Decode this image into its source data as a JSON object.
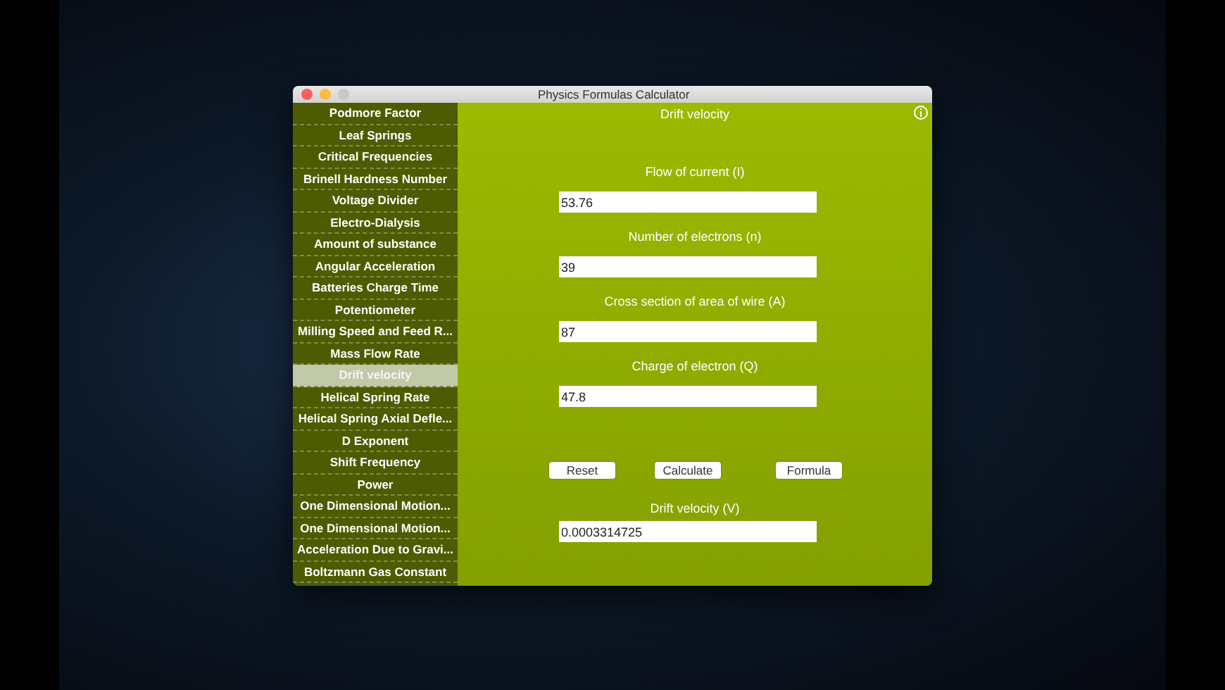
{
  "window": {
    "title": "Physics Formulas Calculator"
  },
  "sidebar": {
    "items": [
      {
        "label": "Podmore Factor",
        "selected": false
      },
      {
        "label": "Leaf Springs",
        "selected": false
      },
      {
        "label": "Critical Frequencies",
        "selected": false
      },
      {
        "label": "Brinell Hardness Number",
        "selected": false
      },
      {
        "label": "Voltage Divider",
        "selected": false
      },
      {
        "label": "Electro-Dialysis",
        "selected": false
      },
      {
        "label": "Amount of substance",
        "selected": false
      },
      {
        "label": "Angular Acceleration",
        "selected": false
      },
      {
        "label": "Batteries Charge Time",
        "selected": false
      },
      {
        "label": "Potentiometer",
        "selected": false
      },
      {
        "label": "Milling Speed and Feed R...",
        "selected": false
      },
      {
        "label": "Mass Flow Rate",
        "selected": false
      },
      {
        "label": "Drift velocity",
        "selected": true
      },
      {
        "label": "Helical Spring Rate",
        "selected": false
      },
      {
        "label": "Helical Spring Axial Defle...",
        "selected": false
      },
      {
        "label": "D Exponent",
        "selected": false
      },
      {
        "label": "Shift Frequency",
        "selected": false
      },
      {
        "label": "Power",
        "selected": false
      },
      {
        "label": "One Dimensional Motion...",
        "selected": false
      },
      {
        "label": "One Dimensional Motion...",
        "selected": false
      },
      {
        "label": "Acceleration Due to Gravi...",
        "selected": false
      },
      {
        "label": "Boltzmann Gas Constant",
        "selected": false
      }
    ]
  },
  "content": {
    "title": "Drift velocity",
    "inputs": [
      {
        "label": "Flow of current (I)",
        "value": "53.76"
      },
      {
        "label": "Number of electrons (n)",
        "value": "39"
      },
      {
        "label": "Cross section of area of wire (A)",
        "value": "87"
      },
      {
        "label": "Charge of electron (Q)",
        "value": "47.8"
      }
    ],
    "buttons": [
      "Reset",
      "Calculate",
      "Formula"
    ],
    "result": {
      "label": "Drift velocity (V)",
      "value": "0.0003314725"
    }
  }
}
